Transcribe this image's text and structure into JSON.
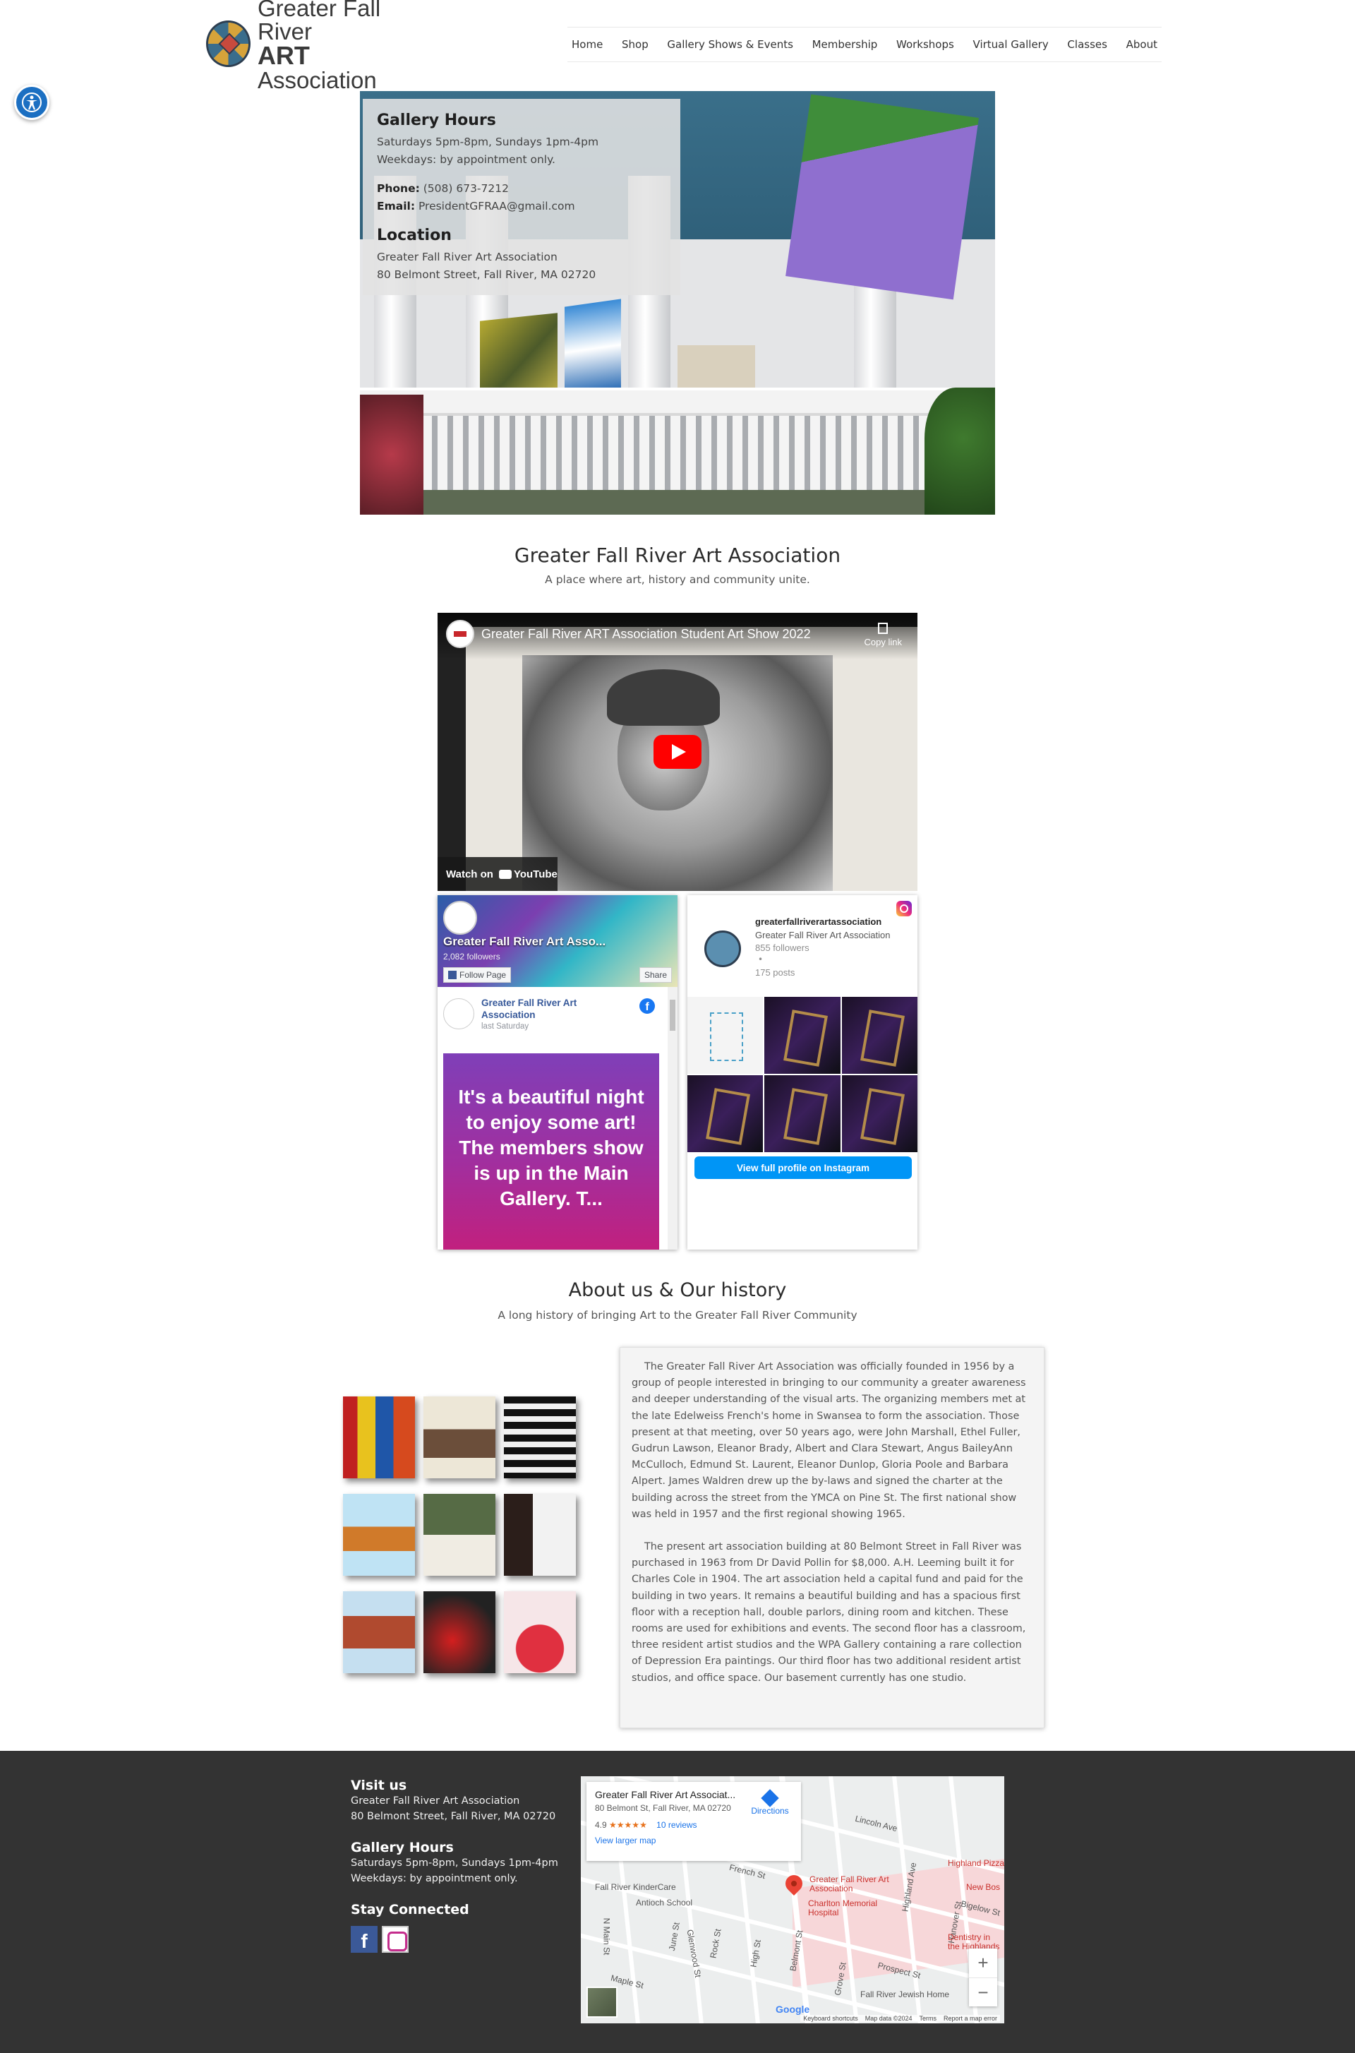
{
  "header": {
    "logo_line1": "Greater Fall River",
    "logo_line2_bold": "ART",
    "logo_line2_rest": "Association",
    "nav": [
      "Home",
      "Shop",
      "Gallery Shows & Events",
      "Membership",
      "Workshops",
      "Virtual Gallery",
      "Classes",
      "About"
    ]
  },
  "accessibility": {
    "icon": "accessibility-icon"
  },
  "hero_card": {
    "hours_title": "Gallery Hours",
    "hours_line1": "Saturdays 5pm-8pm, Sundays 1pm-4pm",
    "hours_line2": "Weekdays: by appointment only.",
    "phone_label": "Phone:",
    "phone": "(508) 673-7212",
    "email_label": "Email:",
    "email": "PresidentGFRAA@gmail.com",
    "location_title": "Location",
    "location_line1": "Greater Fall River Art Association",
    "location_line2": "80 Belmont Street, Fall River, MA 02720"
  },
  "intro": {
    "title": "Greater Fall River Art Association",
    "subtitle": "A place where art, history and community unite."
  },
  "youtube": {
    "title": "Greater Fall River ART Association Student Art Show 2022",
    "copy_link": "Copy link",
    "watch_on": "Watch on",
    "youtube_brand": "YouTube"
  },
  "facebook": {
    "page_name": "Greater Fall River Art Asso...",
    "followers": "2,082 followers",
    "follow_label": "Follow Page",
    "share_label": "Share",
    "post_author": "Greater Fall River Art Association",
    "post_date": "last Saturday",
    "post_text": "It's a beautiful night to enjoy some art! The members show is up in the Main Gallery. T..."
  },
  "instagram": {
    "username": "greaterfallriverartassociation",
    "full_name": "Greater Fall River Art Association",
    "followers": "855 followers",
    "separator": "•",
    "posts": "175 posts",
    "view_button": "View full profile on Instagram"
  },
  "about": {
    "title": "About us & Our history",
    "subtitle": "A long history of bringing Art to the Greater Fall River Community",
    "paragraph1": "The Greater Fall River Art Association was officially founded in 1956 by a group of people interested in bringing to our community a greater awareness and deeper understanding of the visual arts. The organizing members met at the late Edelweiss French's home in Swansea to form the association. Those present at that meeting, over 50 years ago, were John Marshall, Ethel Fuller, Gudrun Lawson, Eleanor Brady, Albert and Clara Stewart, Angus BaileyAnn McCulloch, Edmund St. Laurent, Eleanor Dunlop, Gloria Poole and Barbara Alpert. James Waldren drew up the by-laws and signed the charter at the building across the street from the YMCA on Pine St. The first national show was held in 1957 and the first regional showing 1965.",
    "paragraph2": "The present art association building at 80 Belmont Street in Fall River was purchased in 1963 from Dr David Pollin for $8,000. A.H. Leeming built it for Charles Cole in 1904. The art association held a capital fund and paid for the building in two years. It remains a beautiful building and has a spacious first floor with a reception hall, double parlors, dining room and kitchen. These rooms are used for exhibitions and events. The second floor has a classroom, three resident artist studios and the WPA Gallery containing a rare collection of Depression Era paintings. Our third floor has two additional resident artist studios, and office space. Our basement currently has one studio."
  },
  "footer": {
    "visit_title": "Visit us",
    "visit_line1": "Greater Fall River Art Association",
    "visit_line2": "80 Belmont Street, Fall River, MA 02720",
    "hours_title": "Gallery Hours",
    "hours_line1": "Saturdays 5pm-8pm, Sundays 1pm-4pm",
    "hours_line2": "Weekdays: by appointment only.",
    "connect_title": "Stay Connected",
    "facebook_letter": "f"
  },
  "map": {
    "place_name": "Greater Fall River Art Associat...",
    "address": "80 Belmont St, Fall River, MA 02720",
    "rating": "4.9",
    "stars": "★★★★★",
    "reviews": "10 reviews",
    "larger_map": "View larger map",
    "directions": "Directions",
    "marker_label": "Greater Fall River Art Association",
    "labels": {
      "lincoln": "Lincoln Ave",
      "highland": "Highland Ave",
      "highland_pizza": "Highland Pizza",
      "new_boston": "New Bos",
      "french": "French St",
      "kindercare": "Fall River KinderCare",
      "antioch": "Antioch School",
      "charlton": "Charlton Memorial Hospital",
      "bigelow": "Bigelow St",
      "hanover": "Hanover St",
      "dentistry": "Dentistry in the Highlands",
      "n_main": "N Main St",
      "june": "June St",
      "glenwood": "Glenwood St",
      "rock": "Rock St",
      "high": "High St",
      "belmont": "Belmont St",
      "grove": "Grove St",
      "prospect": "Prospect St",
      "maple": "Maple St",
      "jewish_home": "Fall River Jewish Home"
    },
    "google": "Google",
    "attrib_shortcuts": "Keyboard shortcuts",
    "attrib_data": "Map data ©2024",
    "attrib_terms": "Terms",
    "attrib_report": "Report a map error",
    "zoom_in": "+",
    "zoom_out": "−"
  },
  "colors": {
    "accent_blue": "#1b6fc2",
    "footer_bg": "#333333",
    "instagram_button": "#0095f6",
    "facebook_blue": "#365899",
    "youtube_red": "#ff0000"
  }
}
